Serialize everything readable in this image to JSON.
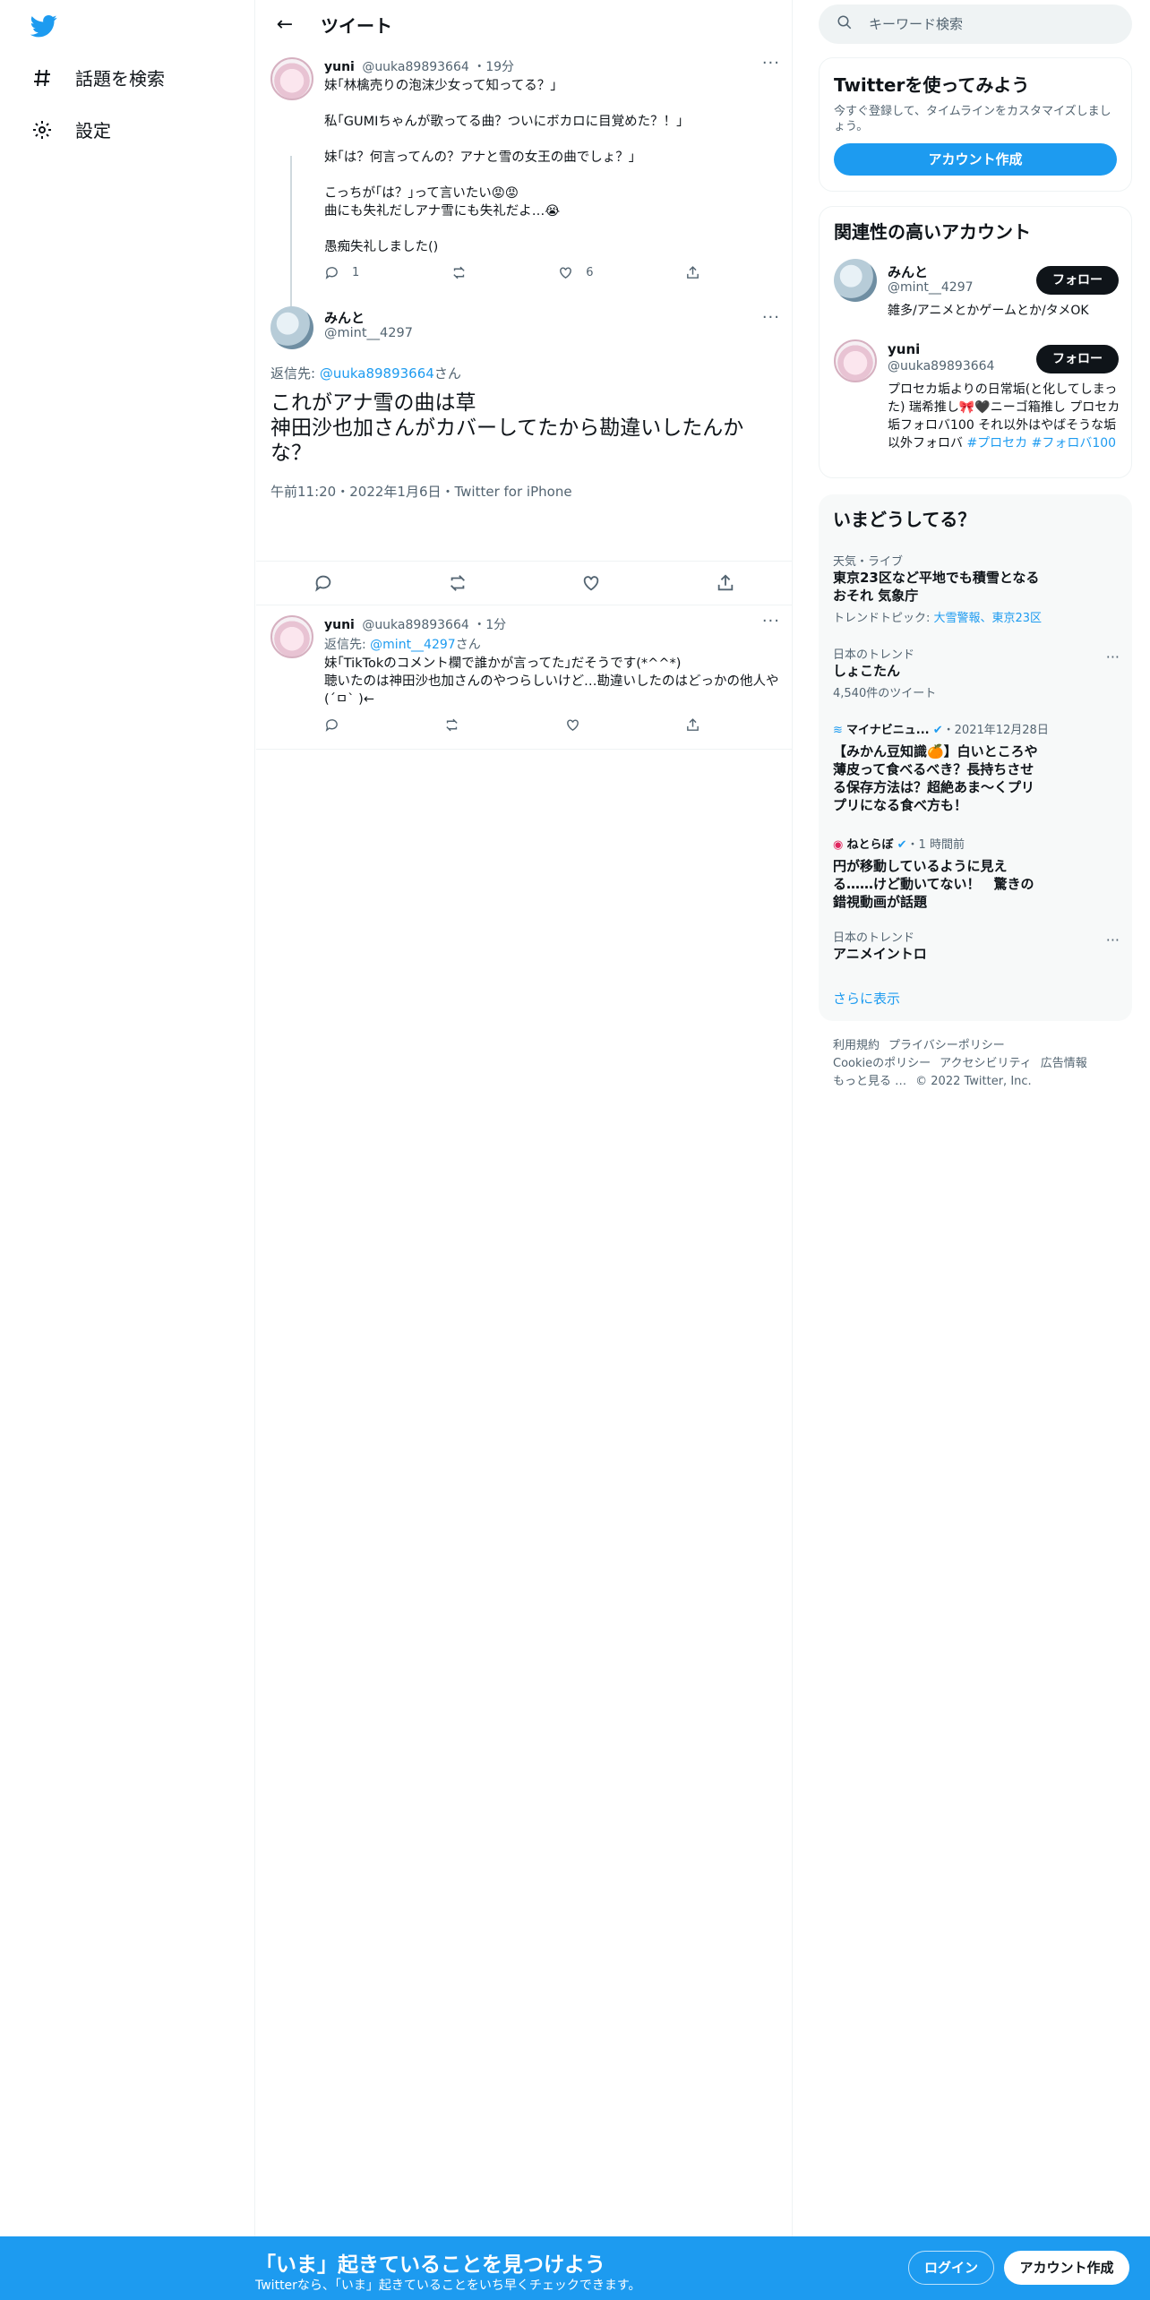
{
  "nav": {
    "items": [
      {
        "label": "話題を検索",
        "icon": "hashtag-icon"
      },
      {
        "label": "設定",
        "icon": "gear-icon"
      }
    ]
  },
  "header": {
    "title": "ツイート"
  },
  "tweet1": {
    "name": "yuni",
    "handle": "@uuka89893664",
    "time": "19分",
    "text": "妹｢林檎売りの泡沫少女って知ってる？｣\n\n私｢GUMIちゃんが歌ってる曲？ついにボカロに目覚めた？！｣\n\n妹｢は？何言ってんの？アナと雪の女王の曲でしょ？｣\n\nこっちが｢は？｣って言いたい😡😡\n曲にも失礼だしアナ雪にも失礼だよ…😭\n\n愚痴失礼しました()",
    "reply_count": "1",
    "like_count": "6"
  },
  "focus": {
    "name": "みんと",
    "handle": "@mint__4297",
    "reply_prefix": "返信先: ",
    "reply_link": "@uuka89893664",
    "reply_suffix": "さん",
    "text": "これがアナ雪の曲は草\n神田沙也加さんがカバーしてたから勘違いしたんかな？",
    "timestamp": "午前11:20・2022年1月6日・Twitter for iPhone"
  },
  "tweet3": {
    "name": "yuni",
    "handle": "@uuka89893664",
    "time": "1分",
    "reply_prefix": "返信先: ",
    "reply_link": "@mint__4297",
    "reply_suffix": "さん",
    "text": "妹｢TikTokのコメント欄で誰かが言ってた｣だそうです(*^^*)\n聴いたのは神田沙也加さんのやつらしいけど…勘違いしたのはどっかの他人や(´ㅁ` )←"
  },
  "search": {
    "placeholder": "キーワード検索"
  },
  "signup_card": {
    "title": "Twitterを使ってみよう",
    "desc": "今すぐ登録して、タイムラインをカスタマイズしましょう。",
    "button": "アカウント作成"
  },
  "related": {
    "title": "関連性の高いアカウント",
    "accounts": [
      {
        "name": "みんと",
        "handle": "@mint__4297",
        "bio": "雑多/アニメとかゲームとか/タメOK",
        "follow": "フォロー"
      },
      {
        "name": "yuni",
        "handle": "@uuka89893664",
        "bio": "プロセカ垢よりの日常垢(と化してしまった) 瑞希推し🎀🖤ニーゴ箱推し プロセカ垢フォロバ100 それ以外はやばそうな垢以外フォロバ ",
        "tags": "#プロセカ #フォロバ100",
        "follow": "フォロー"
      }
    ]
  },
  "trends": {
    "title": "いまどうしてる？",
    "t1": {
      "cat": "天気・ライブ",
      "title": "東京23区など平地でも積雪となるおそれ 気象庁",
      "topic_prefix": "トレンドトピック: ",
      "topic_links": "大雪警報、東京23区"
    },
    "t2": {
      "cat": "日本のトレンド",
      "title": "しょこたん",
      "count": "4,540件のツイート"
    },
    "t3": {
      "source": "マイナビニュ...",
      "date": "・2021年12月28日",
      "title": "【みかん豆知識🍊】白いところや薄皮って食べるべき？長持ちさせる保存方法は？超絶あま～くプリプリになる食べ方も！"
    },
    "t4": {
      "source": "ねとらぼ",
      "date": "・1 時間前",
      "title": "円が移動しているように見える……けど動いてない！　驚きの錯視動画が話題"
    },
    "t5": {
      "cat": "日本のトレンド",
      "title": "アニメイントロ"
    },
    "show_more": "さらに表示"
  },
  "footer": {
    "links": [
      "利用規約",
      "プライバシーポリシー",
      "Cookieのポリシー",
      "アクセシビリティ",
      "広告情報",
      "もっと見る …"
    ],
    "copyright": "© 2022 Twitter, Inc."
  },
  "banner": {
    "headline": "「いま」起きていることを見つけよう",
    "sub": "Twitterなら、「いま」起きていることをいち早くチェックできます。",
    "login": "ログイン",
    "signup": "アカウント作成"
  },
  "colors": {
    "accent": "#1d9bf0",
    "text": "#0f1419",
    "muted": "#536471"
  }
}
